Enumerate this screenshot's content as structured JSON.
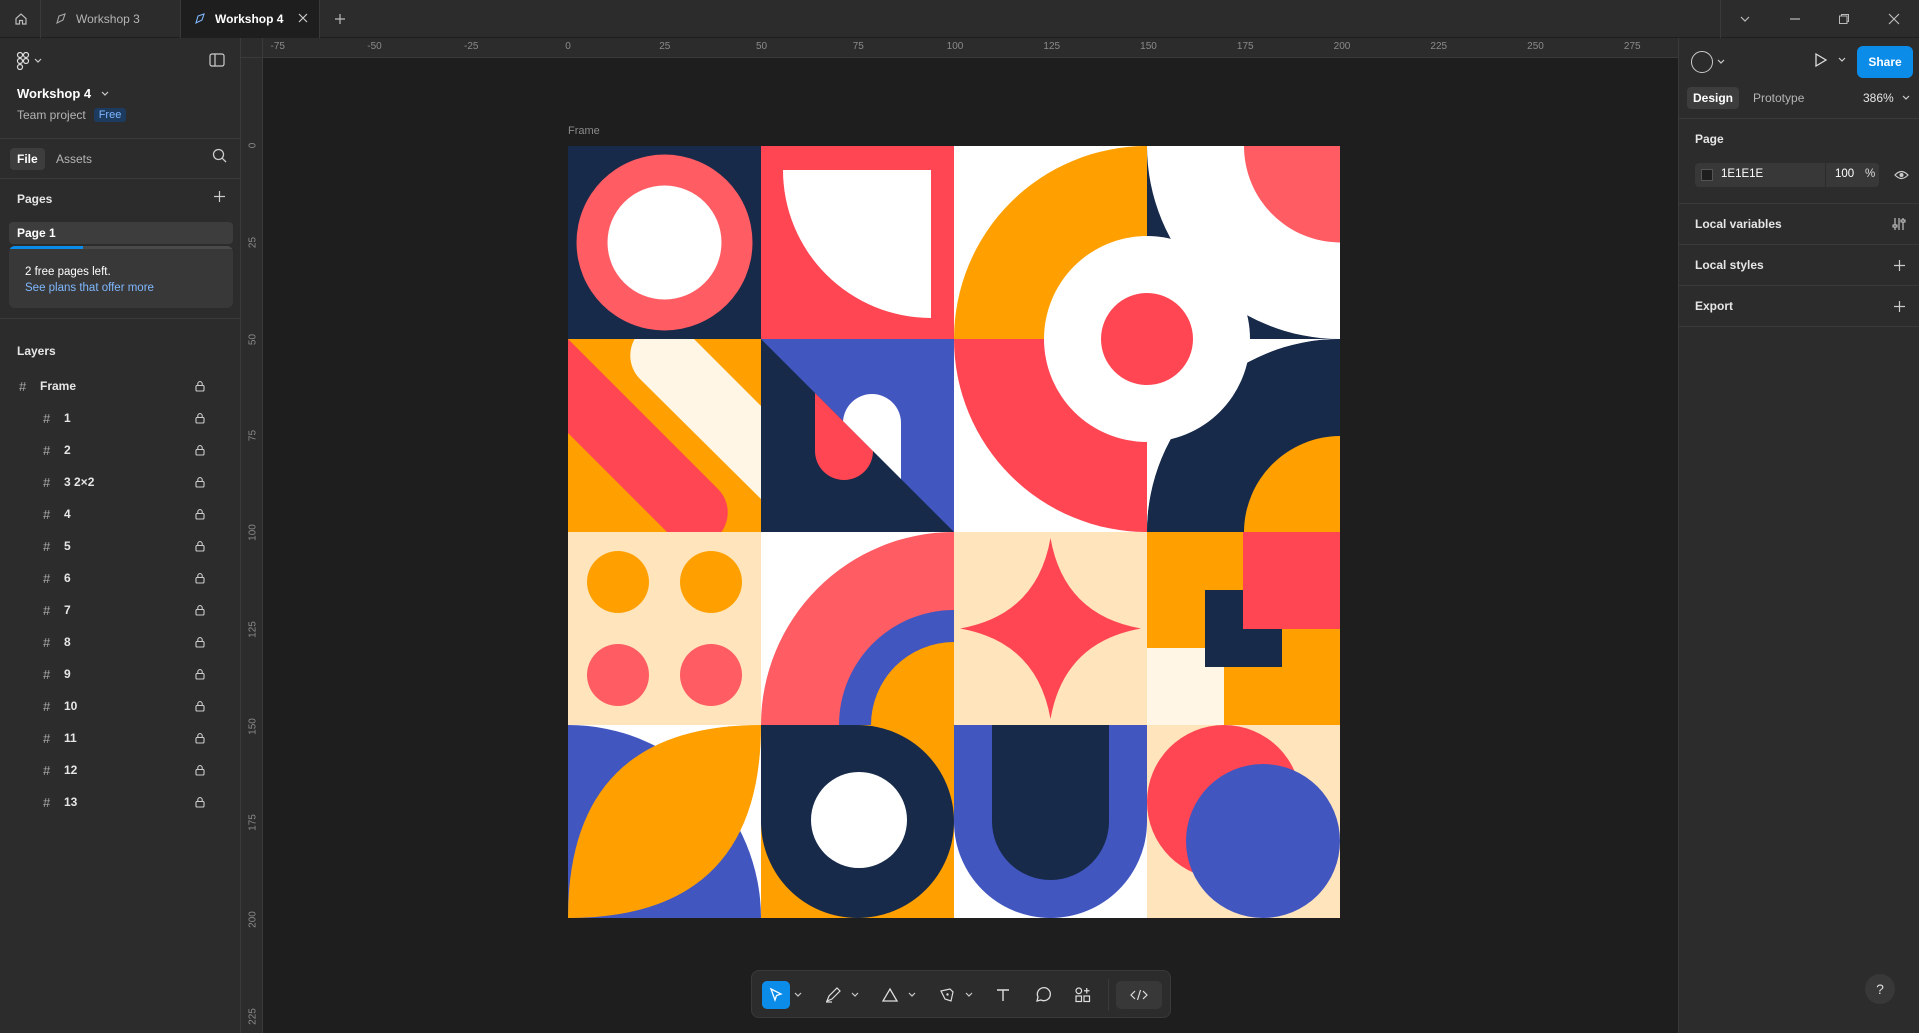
{
  "tabs": [
    {
      "label": "Workshop 3"
    },
    {
      "label": "Workshop 4"
    }
  ],
  "file": {
    "name": "Workshop 4",
    "project": "Team project",
    "plan_badge": "Free"
  },
  "left_tabs": {
    "file": "File",
    "assets": "Assets"
  },
  "pages": {
    "title": "Pages",
    "items": [
      {
        "label": "Page 1"
      }
    ],
    "notice": {
      "line1": "2 free pages left.",
      "link": "See plans that offer more"
    },
    "progress": 0.33
  },
  "layers": {
    "title": "Layers",
    "items": [
      {
        "label": "Frame"
      },
      {
        "label": "1"
      },
      {
        "label": "2"
      },
      {
        "label": "3 2×2"
      },
      {
        "label": "4"
      },
      {
        "label": "5"
      },
      {
        "label": "6"
      },
      {
        "label": "7"
      },
      {
        "label": "8"
      },
      {
        "label": "9"
      },
      {
        "label": "10"
      },
      {
        "label": "11"
      },
      {
        "label": "12"
      },
      {
        "label": "13"
      }
    ]
  },
  "right": {
    "share": "Share",
    "tabs": {
      "design": "Design",
      "prototype": "Prototype"
    },
    "zoom": "386%",
    "page_section": "Page",
    "bg_hex": "1E1E1E",
    "bg_opacity": "100",
    "percent": "%",
    "local_variables": "Local variables",
    "local_styles": "Local styles",
    "export": "Export"
  },
  "canvas": {
    "frame_label": "Frame"
  },
  "ruler_top": [
    "-75",
    "-50",
    "-25",
    "0",
    "25",
    "50",
    "75",
    "100",
    "125",
    "150",
    "175",
    "200",
    "225",
    "250",
    "275"
  ],
  "ruler_left": [
    "0",
    "25",
    "50",
    "75",
    "100",
    "125",
    "150",
    "175",
    "200",
    "225"
  ],
  "help": "?",
  "colors": {
    "navy": "#172a4a",
    "coral": "#ff5c63",
    "red": "#ff4652",
    "orange": "#ffa000",
    "blue": "#4256c0",
    "cream": "#ffe4bc",
    "ivory": "#fff6e6",
    "white": "#ffffff",
    "accent": "#0c8ce9"
  }
}
